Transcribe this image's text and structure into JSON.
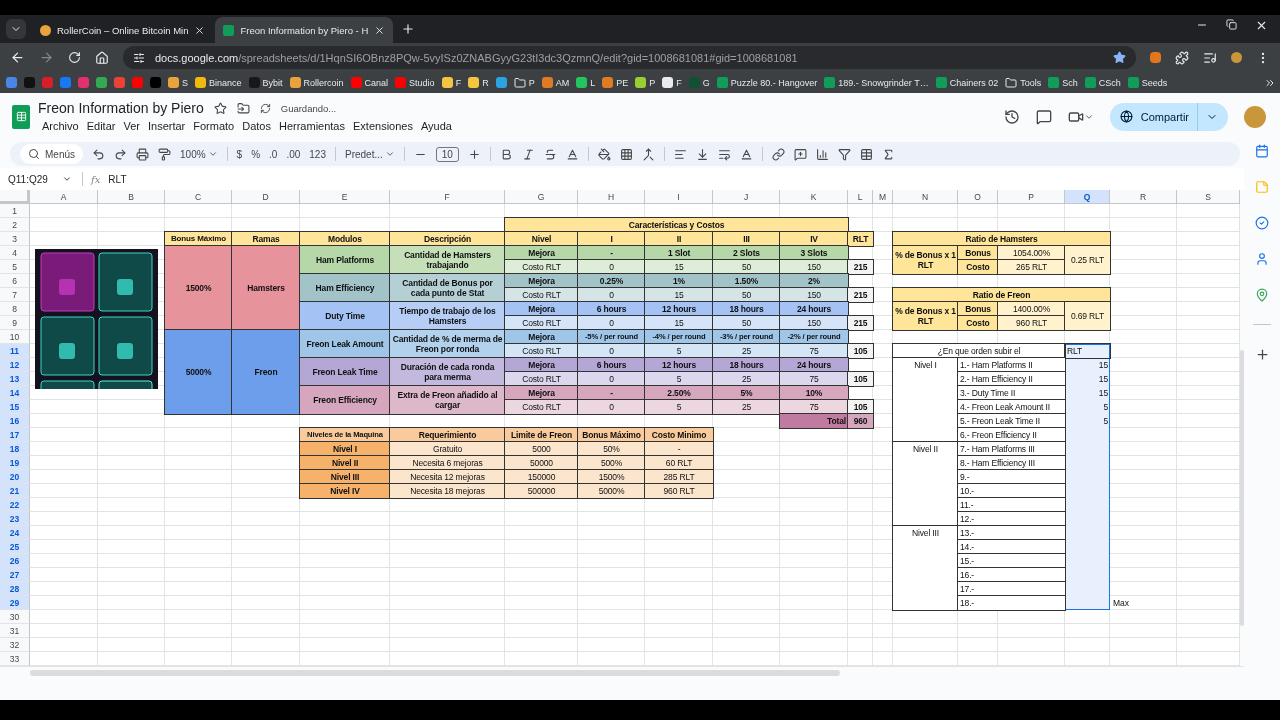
{
  "browser": {
    "tabs": [
      {
        "title": "RollerCoin – Online Bitcoin Min",
        "selected": false
      },
      {
        "title": "Freon Information by Piero - H",
        "selected": true
      }
    ],
    "address": {
      "host": "docs.google.com",
      "path": "/spreadsheets/d/1HqnSI6OBnz8PQw-5vyISz0ZNABGyyG23tI3dc3QzmnQ/edit?gid=1008681081#gid=1008681081"
    },
    "bookmarks": [
      {
        "kind": "site",
        "color": "#4a86e8"
      },
      {
        "kind": "site",
        "color": "#111111"
      },
      {
        "kind": "site",
        "color": "#d81f26"
      },
      {
        "kind": "site",
        "color": "#1877f2"
      },
      {
        "kind": "site",
        "color": "#e1306c"
      },
      {
        "kind": "site",
        "color": "#34a853"
      },
      {
        "kind": "site",
        "color": "#ea4335"
      },
      {
        "kind": "site",
        "color": "#ff0000"
      },
      {
        "kind": "site",
        "color": "#000000"
      },
      {
        "kind": "site",
        "color": "#e8a33d",
        "label": "S"
      },
      {
        "kind": "site",
        "color": "#f0b90b",
        "label": "Binance"
      },
      {
        "kind": "site",
        "color": "#17181e",
        "label": "Bybit"
      },
      {
        "kind": "site",
        "color": "#e8a33d",
        "label": "Rollercoin"
      },
      {
        "kind": "site",
        "color": "#ff0000",
        "label": "Canal"
      },
      {
        "kind": "site",
        "color": "#ff0000",
        "label": "Studio"
      },
      {
        "kind": "site",
        "color": "#f5c542",
        "label": "F"
      },
      {
        "kind": "site",
        "color": "#f5c542",
        "label": "R"
      },
      {
        "kind": "site",
        "color": "#2aa3de"
      },
      {
        "kind": "folder",
        "label": "P"
      },
      {
        "kind": "site",
        "color": "#e07b24",
        "label": "AM"
      },
      {
        "kind": "site",
        "color": "#22c55e",
        "label": "L"
      },
      {
        "kind": "site",
        "color": "#e07b24",
        "label": "PE"
      },
      {
        "kind": "site",
        "color": "#9acd32",
        "label": "P"
      },
      {
        "kind": "site",
        "color": "#e8eaed",
        "label": "F"
      },
      {
        "kind": "site",
        "color": "#0f5132",
        "label": "G"
      },
      {
        "kind": "sheet",
        "label": "Puzzle 80.- Hangover"
      },
      {
        "kind": "sheet",
        "label": "189.- Snowgrinder T…"
      },
      {
        "kind": "sheet",
        "label": "Chainers 02"
      },
      {
        "kind": "folder",
        "label": "Tools"
      },
      {
        "kind": "sheet",
        "label": "Sch"
      },
      {
        "kind": "sheet",
        "label": "CSch"
      },
      {
        "kind": "sheet",
        "label": "Seeds"
      }
    ]
  },
  "app": {
    "title": "Freon Information by Piero",
    "save_status": "Guardando...",
    "menus": [
      "Archivo",
      "Editar",
      "Ver",
      "Insertar",
      "Formato",
      "Datos",
      "Herramientas",
      "Extensiones",
      "Ayuda"
    ],
    "share": "Compartir"
  },
  "toolbar": {
    "search": "Menús",
    "zoom": "100%",
    "currency": "$",
    "percent": "%",
    "decrease_decimals": ".0",
    "increase_decimals": ".00",
    "number_format": "123",
    "font": "Predet...",
    "font_size": "10"
  },
  "formula_bar": {
    "name_box": "Q11:Q29",
    "fx": "fx",
    "formula": "RLT"
  },
  "sheet": {
    "columns": [
      {
        "label": "A",
        "selected": false
      },
      {
        "label": "B",
        "selected": false
      },
      {
        "label": "C",
        "selected": false
      },
      {
        "label": "D",
        "selected": false
      },
      {
        "label": "E",
        "selected": false
      },
      {
        "label": "F",
        "selected": false
      },
      {
        "label": "G",
        "selected": false
      },
      {
        "label": "H",
        "selected": false
      },
      {
        "label": "I",
        "selected": false
      },
      {
        "label": "J",
        "selected": false
      },
      {
        "label": "K",
        "selected": false
      },
      {
        "label": "L",
        "selected": false
      },
      {
        "label": "M",
        "selected": false
      },
      {
        "label": "N",
        "selected": false
      },
      {
        "label": "O",
        "selected": false
      },
      {
        "label": "P",
        "selected": false
      },
      {
        "label": "Q",
        "selected": true
      },
      {
        "label": "R",
        "selected": false
      },
      {
        "label": "S",
        "selected": false
      }
    ],
    "rows": [
      {
        "label": "1",
        "selected": false
      },
      {
        "label": "2",
        "selected": false
      },
      {
        "label": "3",
        "selected": false
      },
      {
        "label": "4",
        "selected": false
      },
      {
        "label": "5",
        "selected": false
      },
      {
        "label": "6",
        "selected": false
      },
      {
        "label": "7",
        "selected": false
      },
      {
        "label": "8",
        "selected": false
      },
      {
        "label": "9",
        "selected": false
      },
      {
        "label": "10",
        "selected": false
      },
      {
        "label": "11",
        "selected": true
      },
      {
        "label": "12",
        "selected": true
      },
      {
        "label": "13",
        "selected": true
      },
      {
        "label": "14",
        "selected": true
      },
      {
        "label": "15",
        "selected": true
      },
      {
        "label": "16",
        "selected": true
      },
      {
        "label": "17",
        "selected": true
      },
      {
        "label": "18",
        "selected": true
      },
      {
        "label": "19",
        "selected": true
      },
      {
        "label": "20",
        "selected": true
      },
      {
        "label": "21",
        "selected": true
      },
      {
        "label": "22",
        "selected": true
      },
      {
        "label": "23",
        "selected": true
      },
      {
        "label": "24",
        "selected": true
      },
      {
        "label": "25",
        "selected": true
      },
      {
        "label": "26",
        "selected": true
      },
      {
        "label": "27",
        "selected": true
      },
      {
        "label": "28",
        "selected": true
      },
      {
        "label": "29",
        "selected": true
      },
      {
        "label": "30",
        "selected": false
      },
      {
        "label": "31",
        "selected": false
      },
      {
        "label": "32",
        "selected": false
      },
      {
        "label": "33",
        "selected": false
      }
    ],
    "main_table": {
      "title": "Características y Costos",
      "columns": [
        "Bonus Máximo",
        "Ramas",
        "Modulos",
        "Descripción",
        "Nivel",
        "I",
        "II",
        "III",
        "IV",
        "RLT"
      ],
      "branches": [
        {
          "bonus": "1500%",
          "name": "Hamsters",
          "color": "#e6939b",
          "modules": [
            {
              "name": "Ham Platforms",
              "description": "Cantidad de Hamsters trabajando",
              "color": "#b6d7a8",
              "rows": [
                {
                  "label": "Mejora",
                  "values": [
                    "-",
                    "1 Slot",
                    "2 Slots",
                    "3 Slots"
                  ]
                },
                {
                  "label": "Costo RLT",
                  "values": [
                    "0",
                    "15",
                    "50",
                    "150"
                  ],
                  "total": "215"
                }
              ]
            },
            {
              "name": "Ham Efficiency",
              "description": "Cantidad de Bonus por cada punto de Stat",
              "color": "#a2c4c9",
              "rows": [
                {
                  "label": "Mejora",
                  "values": [
                    "0.25%",
                    "1%",
                    "1.50%",
                    "2%"
                  ]
                },
                {
                  "label": "Costo RLT",
                  "values": [
                    "0",
                    "15",
                    "50",
                    "150"
                  ],
                  "total": "215"
                }
              ]
            },
            {
              "name": "Duty Time",
              "description": "Tiempo de trabajo de los Hamsters",
              "color": "#a4c2f4",
              "rows": [
                {
                  "label": "Mejora",
                  "values": [
                    "6 hours",
                    "12 hours",
                    "18 hours",
                    "24 hours"
                  ]
                },
                {
                  "label": "Costo RLT",
                  "values": [
                    "0",
                    "15",
                    "50",
                    "150"
                  ],
                  "total": "215"
                }
              ]
            }
          ]
        },
        {
          "bonus": "5000%",
          "name": "Freon",
          "color": "#6d9eeb",
          "modules": [
            {
              "name": "Freon Leak Amount",
              "description": "Cantidad de % de merma de Freon por ronda",
              "color": "#9fc5e8",
              "rows": [
                {
                  "label": "Mejora",
                  "values": [
                    "-5% / per round",
                    "-4% / per round",
                    "-3% / per round",
                    "-2% / per round"
                  ]
                },
                {
                  "label": "Costo RLT",
                  "values": [
                    "0",
                    "5",
                    "25",
                    "75"
                  ],
                  "total": "105"
                }
              ]
            },
            {
              "name": "Freon Leak Time",
              "description": "Duración de cada ronda para merma",
              "color": "#b4a7d6",
              "rows": [
                {
                  "label": "Mejora",
                  "values": [
                    "6 hours",
                    "12 hours",
                    "18 hours",
                    "24 hours"
                  ]
                },
                {
                  "label": "Costo RLT",
                  "values": [
                    "0",
                    "5",
                    "25",
                    "75"
                  ],
                  "total": "105"
                }
              ]
            },
            {
              "name": "Freon Efficiency",
              "description": "Extra de Freon añadido al cargar",
              "color": "#d5a6bd",
              "rows": [
                {
                  "label": "Mejora",
                  "values": [
                    "-",
                    "2.50%",
                    "5%",
                    "10%"
                  ]
                },
                {
                  "label": "Costo RLT",
                  "values": [
                    "0",
                    "5",
                    "25",
                    "75"
                  ],
                  "total": "105"
                }
              ]
            }
          ]
        }
      ],
      "total": {
        "label": "Total",
        "value": "960"
      }
    },
    "levels_table": {
      "columns": [
        "Niveles de la Maquina",
        "Requerimiento",
        "Limite de Freon",
        "Bonus Máximo",
        "Costo Minimo"
      ],
      "rows": [
        [
          "Nivel I",
          "Gratuito",
          "5000",
          "50%",
          "-"
        ],
        [
          "Nivel II",
          "Necesita 6 mejoras",
          "50000",
          "500%",
          "60 RLT"
        ],
        [
          "Nivel III",
          "Necesita 12 mejoras",
          "150000",
          "1500%",
          "285 RLT"
        ],
        [
          "Nivel IV",
          "Necesita 18 mejoras",
          "500000",
          "5000%",
          "960 RLT"
        ]
      ]
    },
    "ratios": [
      {
        "title": "Ratio de Hamsters",
        "label": "% de Bonus x 1 RLT",
        "rows": [
          {
            "name": "Bonus",
            "value": "1054.00%"
          },
          {
            "name": "Costo",
            "value": "265 RLT"
          }
        ],
        "result": "0.25 RLT"
      },
      {
        "title": "Ratio de Freon",
        "label": "% de Bonus x 1 RLT",
        "rows": [
          {
            "name": "Bonus",
            "value": "1400.00%"
          },
          {
            "name": "Costo",
            "value": "960 RLT"
          }
        ],
        "result": "0.69 RLT"
      }
    ],
    "order_table": {
      "question": "¿En que orden subir el",
      "header": "RLT",
      "selected": true,
      "note": "Max",
      "groups": [
        {
          "level": "Nivel I",
          "steps": [
            {
              "step": "1.- Ham Platforms II",
              "rlt": "15"
            },
            {
              "step": "2.- Ham Efficiency II",
              "rlt": "15"
            },
            {
              "step": "3.- Duty Time II",
              "rlt": "15"
            },
            {
              "step": "4.- Freon Leak Amount II",
              "rlt": "5"
            },
            {
              "step": "5.- Freon Leak Time II",
              "rlt": "5"
            },
            {
              "step": "6.- Freon Efficiency II"
            }
          ]
        },
        {
          "level": "Nivel II",
          "steps": [
            {
              "step": "7.- Ham Platforms III"
            },
            {
              "step": "8.- Ham Efficiency III"
            },
            {
              "step": "9.-"
            },
            {
              "step": "10.-"
            },
            {
              "step": "11.-"
            },
            {
              "step": "12.-"
            }
          ]
        },
        {
          "level": "Nivel III",
          "steps": [
            {
              "step": "13.-"
            },
            {
              "step": "14.-"
            },
            {
              "step": "15.-"
            },
            {
              "step": "16.-"
            },
            {
              "step": "17.-"
            },
            {
              "step": "18.-"
            }
          ]
        }
      ]
    }
  }
}
